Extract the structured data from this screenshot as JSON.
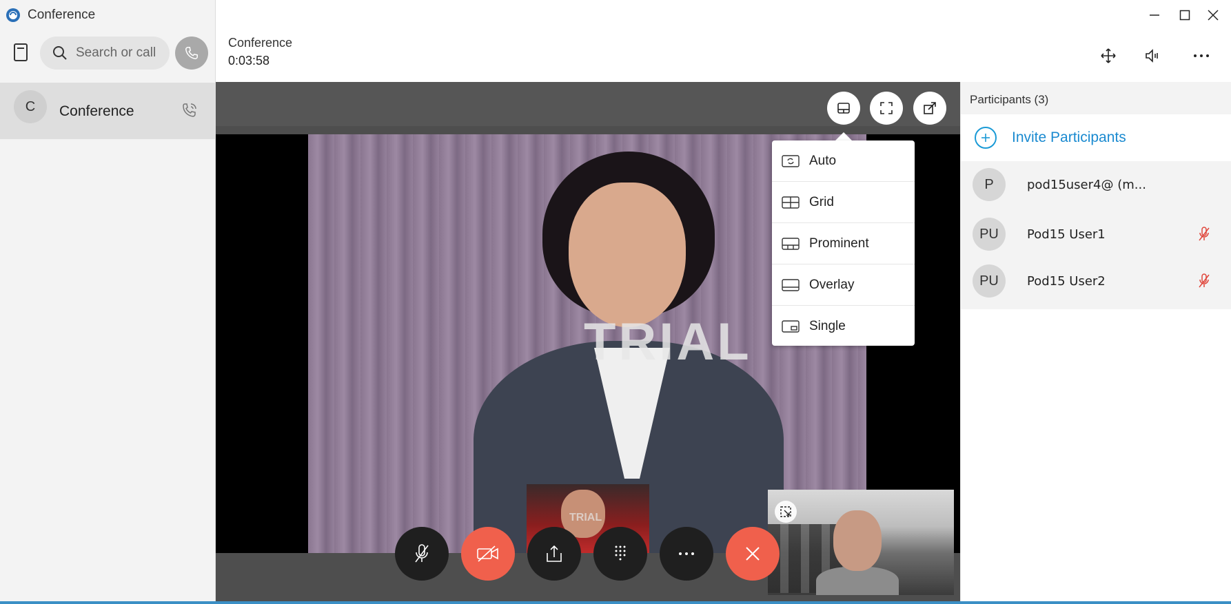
{
  "app": {
    "title": "Conference"
  },
  "search": {
    "placeholder": "Search or call"
  },
  "conversation": {
    "avatar_initial": "C",
    "label": "Conference"
  },
  "call": {
    "title": "Conference",
    "timer": "0:03:58"
  },
  "video": {
    "watermark": "TRIAL",
    "thumb_watermark": "TRIAL"
  },
  "layout_menu": {
    "items": [
      {
        "label": "Auto",
        "icon": "auto-layout-icon"
      },
      {
        "label": "Grid",
        "icon": "grid-layout-icon"
      },
      {
        "label": "Prominent",
        "icon": "prominent-layout-icon"
      },
      {
        "label": "Overlay",
        "icon": "overlay-layout-icon"
      },
      {
        "label": "Single",
        "icon": "single-layout-icon"
      }
    ]
  },
  "participants": {
    "title": "Participants (3)",
    "invite_label": "Invite Participants",
    "list": [
      {
        "initials": "P",
        "name": "pod15user4@ (m...",
        "muted": false
      },
      {
        "initials": "PU",
        "name": "Pod15 User1",
        "muted": true
      },
      {
        "initials": "PU",
        "name": "Pod15 User2",
        "muted": true
      }
    ]
  },
  "colors": {
    "accent": "#1a8ad0",
    "end_call": "#f0604c",
    "video_off": "#f0604c",
    "muted": "#e0453a"
  }
}
